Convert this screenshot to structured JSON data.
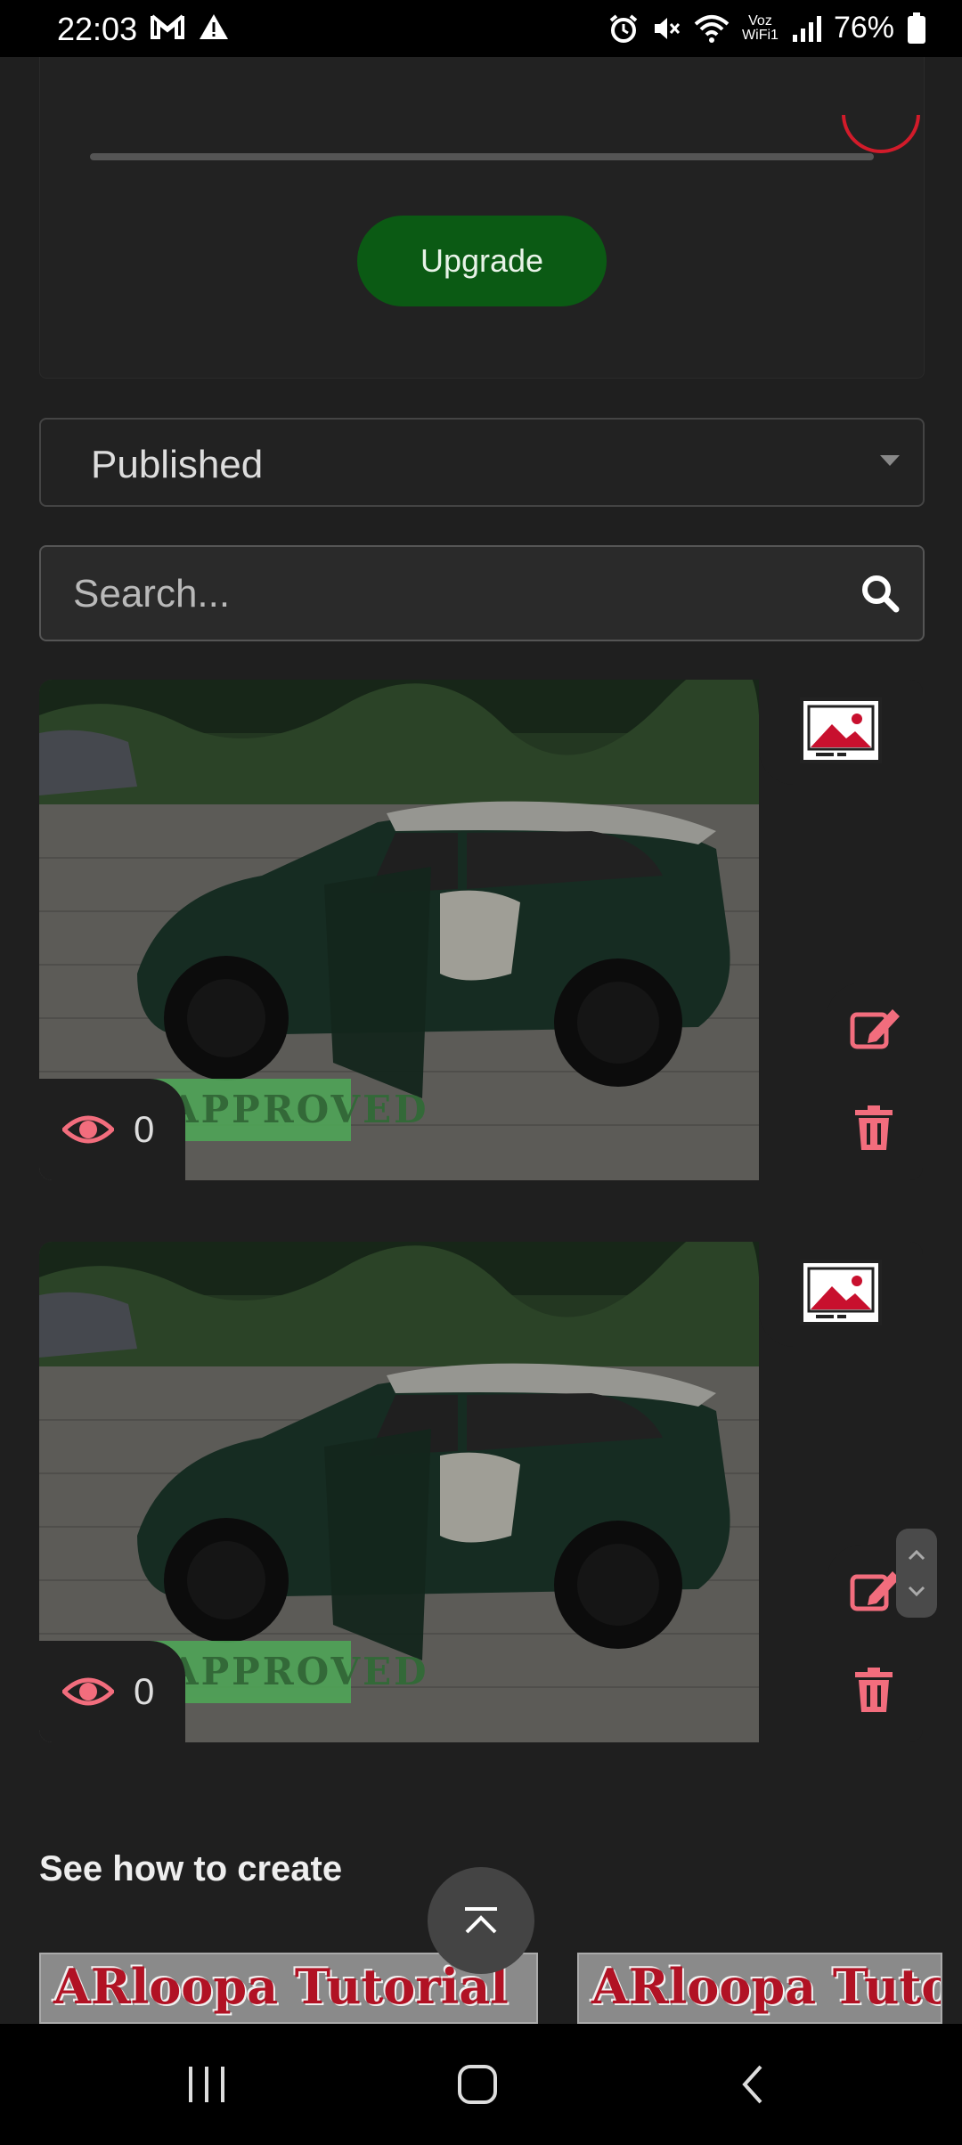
{
  "status_bar": {
    "time": "22:03",
    "network_label_top": "Voz",
    "network_label_bottom": "WiFi1",
    "battery": "76%"
  },
  "upgrade": {
    "button_label": "Upgrade"
  },
  "filter": {
    "selected": "Published"
  },
  "search": {
    "placeholder": "Search..."
  },
  "cards": [
    {
      "status": "APPROVED",
      "views": "0"
    },
    {
      "status": "APPROVED",
      "views": "0"
    }
  ],
  "tutorials": {
    "heading": "See how to create",
    "items": [
      "ARloopa Tutorial",
      "ARloopa Tutorial"
    ]
  },
  "colors": {
    "accent_green": "#0b5a14",
    "icon_red": "#f26d7d",
    "approved_green": "#4fa557"
  }
}
